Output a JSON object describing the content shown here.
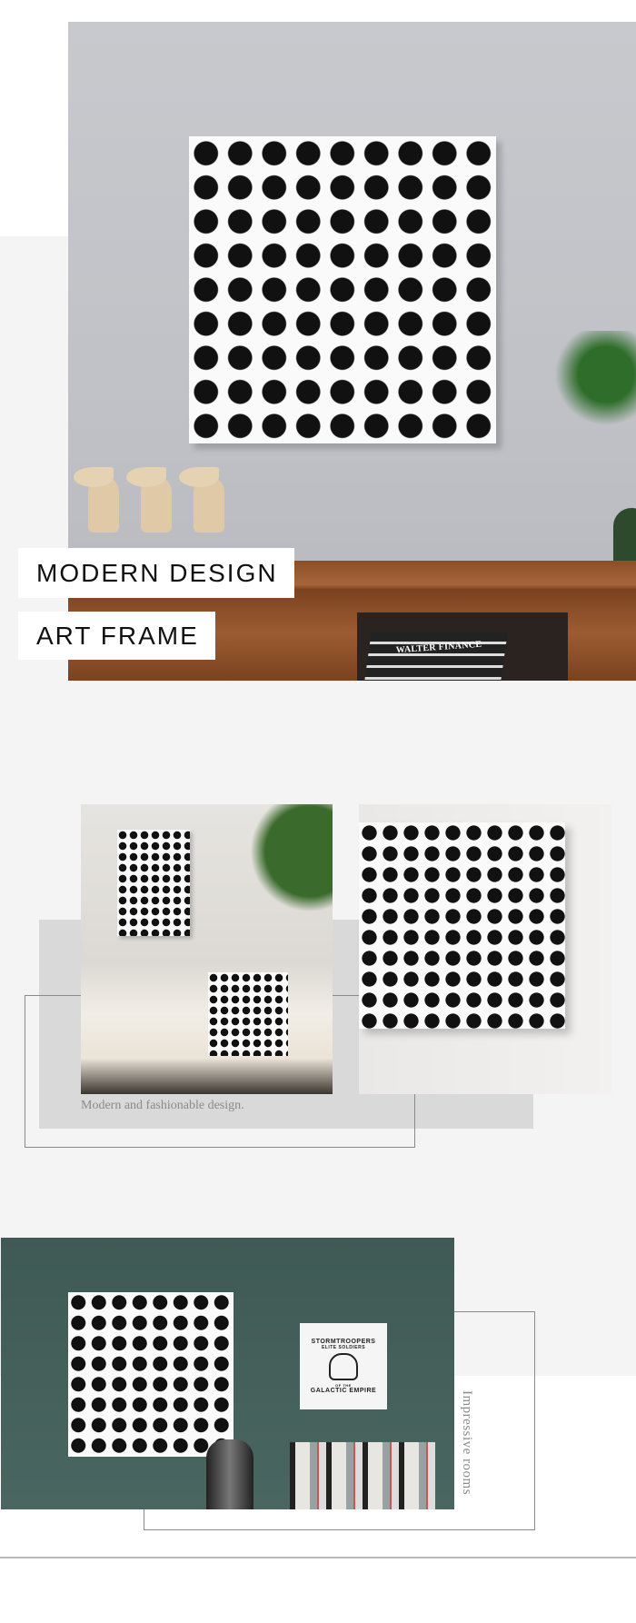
{
  "hero": {
    "title_line1": "MODERN DESIGN",
    "title_line2": "ART FRAME",
    "books_text": "WALTER FINANCE"
  },
  "gallery": {
    "caption": "Modern and fashionable design."
  },
  "room": {
    "side_label": "Impressive rooms",
    "poster": {
      "top_text": "STORMTROOPERS",
      "sub_text": "ELITE SOLDIERS",
      "of_text": "OF THE",
      "bottom_text": "GALACTIC EMPIRE"
    }
  },
  "colors": {
    "page_gray": "#f4f4f4",
    "box_gray": "#d9d9d9",
    "wall_green": "#42605a",
    "caption_gray": "#8a8a8a"
  }
}
